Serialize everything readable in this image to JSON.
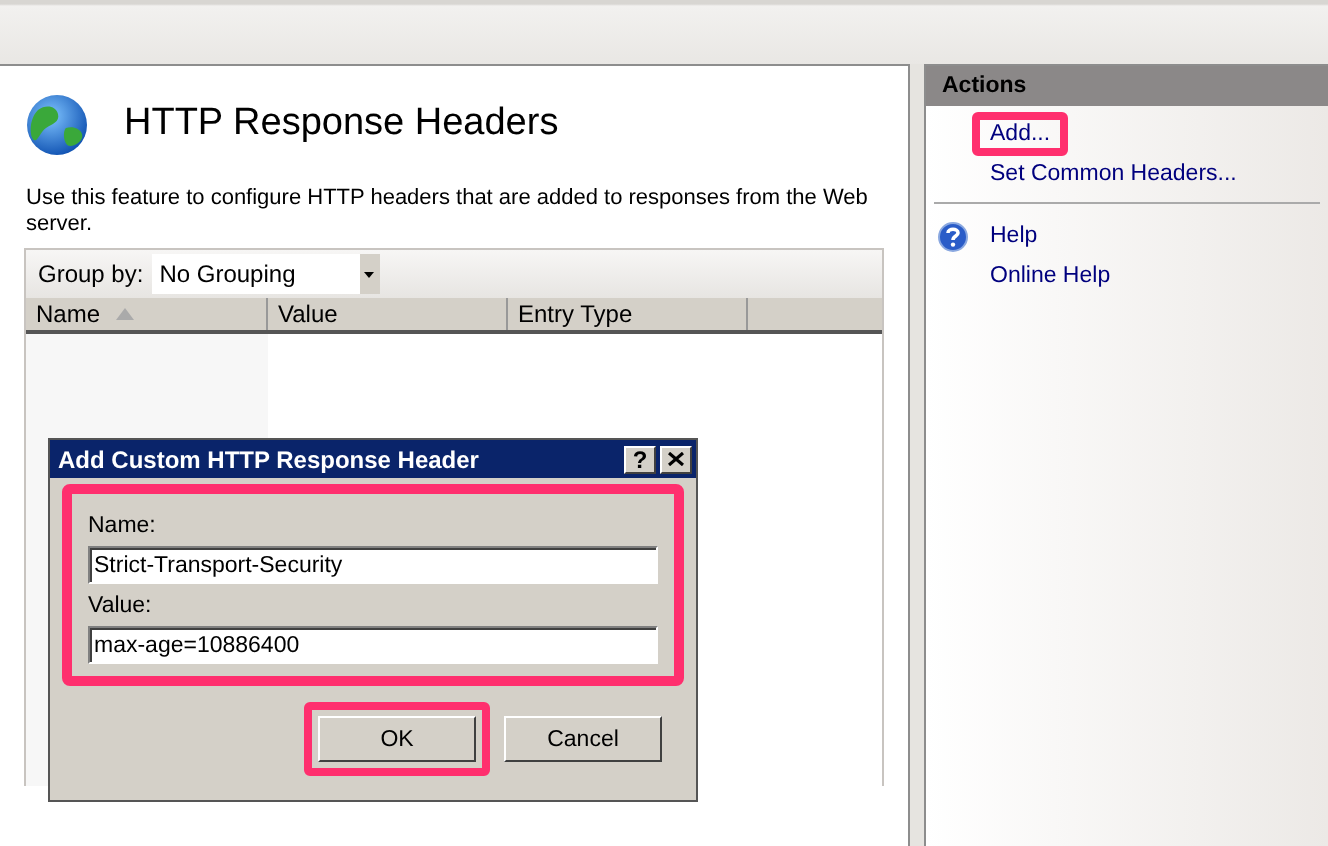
{
  "feature": {
    "title": "HTTP Response Headers",
    "description": "Use this feature to configure HTTP headers that are added to responses from the Web server.",
    "group_by": {
      "label": "Group by:",
      "value": "No Grouping"
    },
    "columns": [
      {
        "label": "Name",
        "sorted": true
      },
      {
        "label": "Value",
        "sorted": false
      },
      {
        "label": "Entry Type",
        "sorted": false
      }
    ]
  },
  "actions": {
    "title": "Actions",
    "groups": [
      [
        {
          "kind": "link",
          "label": "Add...",
          "highlighted": true
        },
        {
          "kind": "link",
          "label": "Set Common Headers...",
          "highlighted": false
        }
      ],
      [
        {
          "kind": "help",
          "label": "Help",
          "highlighted": false
        },
        {
          "kind": "link",
          "label": "Online Help",
          "highlighted": false
        }
      ]
    ]
  },
  "dialog": {
    "title": "Add Custom HTTP Response Header",
    "help_button": "?",
    "fields_highlighted": true,
    "fields": [
      {
        "label": "Name:",
        "value": "Strict-Transport-Security"
      },
      {
        "label": "Value:",
        "value": "max-age=10886400"
      }
    ],
    "buttons": [
      {
        "label": "OK",
        "highlighted": true
      },
      {
        "label": "Cancel",
        "highlighted": false
      }
    ]
  }
}
